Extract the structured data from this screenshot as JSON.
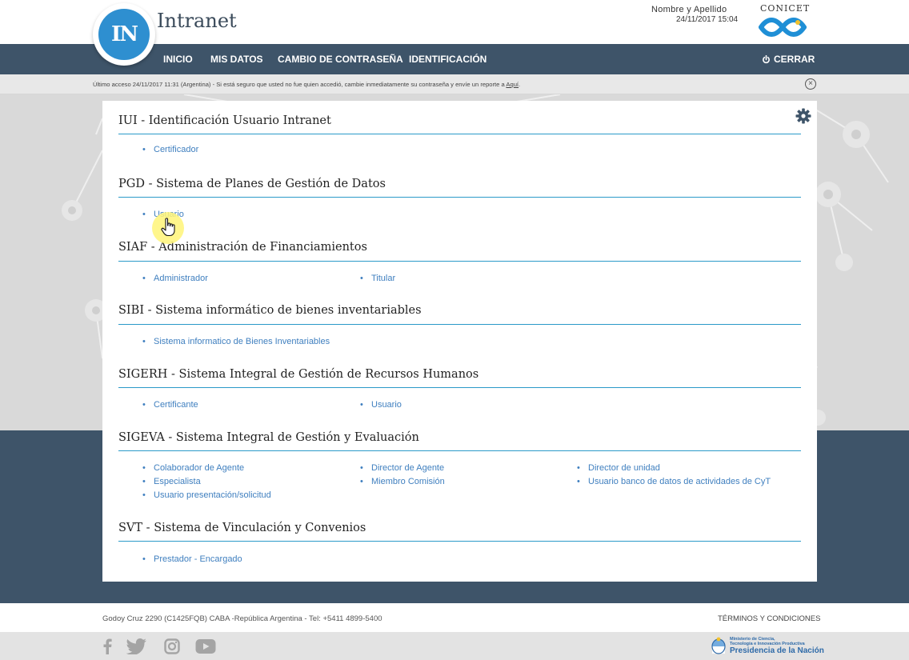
{
  "header": {
    "logo_text": "IN",
    "app_title": "Intranet",
    "user_name": "Nombre y Apellido",
    "user_datetime": "24/11/2017 15:04",
    "institution": "CONICET"
  },
  "nav": {
    "items": [
      "INICIO",
      "MIS DATOS",
      "CAMBIO DE CONTRASEÑA",
      "IDENTIFICACIÓN"
    ],
    "logout_label": "CERRAR"
  },
  "notice": {
    "text": "Último acceso 24/11/2017 11:31 (Argentina) -  Si está seguro que usted no fue quien accedió, cambie inmediatamente su contraseña y envíe un reporte a ",
    "link_label": "Aquí",
    "suffix": "."
  },
  "sections": [
    {
      "title": "IUI - Identificación Usuario Intranet",
      "links": [
        "Certificador"
      ]
    },
    {
      "title": "PGD - Sistema de Planes de Gestión de Datos",
      "links": [
        "Usuario"
      ]
    },
    {
      "title": "SIAF - Administración de Financiamientos",
      "links": [
        "Administrador",
        "Titular"
      ]
    },
    {
      "title": "SIBI - Sistema informático de bienes inventariables",
      "links": [
        "Sistema informatico de Bienes Inventariables"
      ]
    },
    {
      "title": "SIGERH - Sistema Integral de Gestión de Recursos Humanos",
      "links": [
        "Certificante",
        "Usuario"
      ]
    },
    {
      "title": "SIGEVA - Sistema Integral de Gestión y Evaluación",
      "links": [
        "Colaborador de Agente",
        "Director de Agente",
        "Director de unidad",
        "Especialista",
        "Miembro Comisión",
        "Usuario banco de datos de actividades de CyT",
        "Usuario presentación/solicitud"
      ]
    },
    {
      "title": "SVT - Sistema de Vinculación y Convenios",
      "links": [
        "Prestador - Encargado"
      ]
    }
  ],
  "footer": {
    "address": "Godoy Cruz 2290 (C1425FQB) CABA -República Argentina - Tel: +5411 4899-5400",
    "terms": "TÉRMINOS Y CONDICIONES",
    "ministry_line1": "Ministerio de Ciencia,",
    "ministry_line2": "Tecnología e Innovación Productiva",
    "ministry_line3": "Presidencia de la Nación"
  },
  "icons": {
    "social": [
      "facebook-icon",
      "twitter-icon",
      "instagram-icon",
      "youtube-icon"
    ],
    "settings": "gear-icon",
    "logout": "power-icon",
    "close": "close-icon"
  },
  "colors": {
    "navbar": "#3e5469",
    "accent": "#2b9ac9",
    "link": "#3f7fbf",
    "logo": "#2e8fd0"
  }
}
